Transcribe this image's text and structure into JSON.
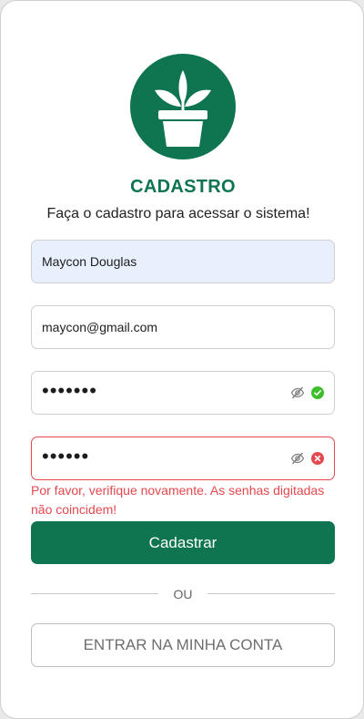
{
  "app": {
    "title": "CADASTRO",
    "subtitle": "Faça o cadastro para acessar o sistema!",
    "brand_color": "#0e7550",
    "error_color": "#e5484d",
    "success_color": "#3cbf2b"
  },
  "form": {
    "name_value": "Maycon Douglas",
    "email_value": "maycon@gmail.com",
    "password_value": "•••••••",
    "confirm_value": "••••••",
    "error_message": "Por favor, verifique novamente. As senhas digitadas não coincidem!",
    "submit_label": "Cadastrar"
  },
  "divider": {
    "label": "OU"
  },
  "login_button": {
    "label": "ENTRAR NA MINHA CONTA"
  },
  "icons": {
    "logo": "plant-pot-icon",
    "password_toggle": "eye-off-icon",
    "password_ok": "check-circle-icon",
    "confirm_error": "x-circle-icon"
  }
}
